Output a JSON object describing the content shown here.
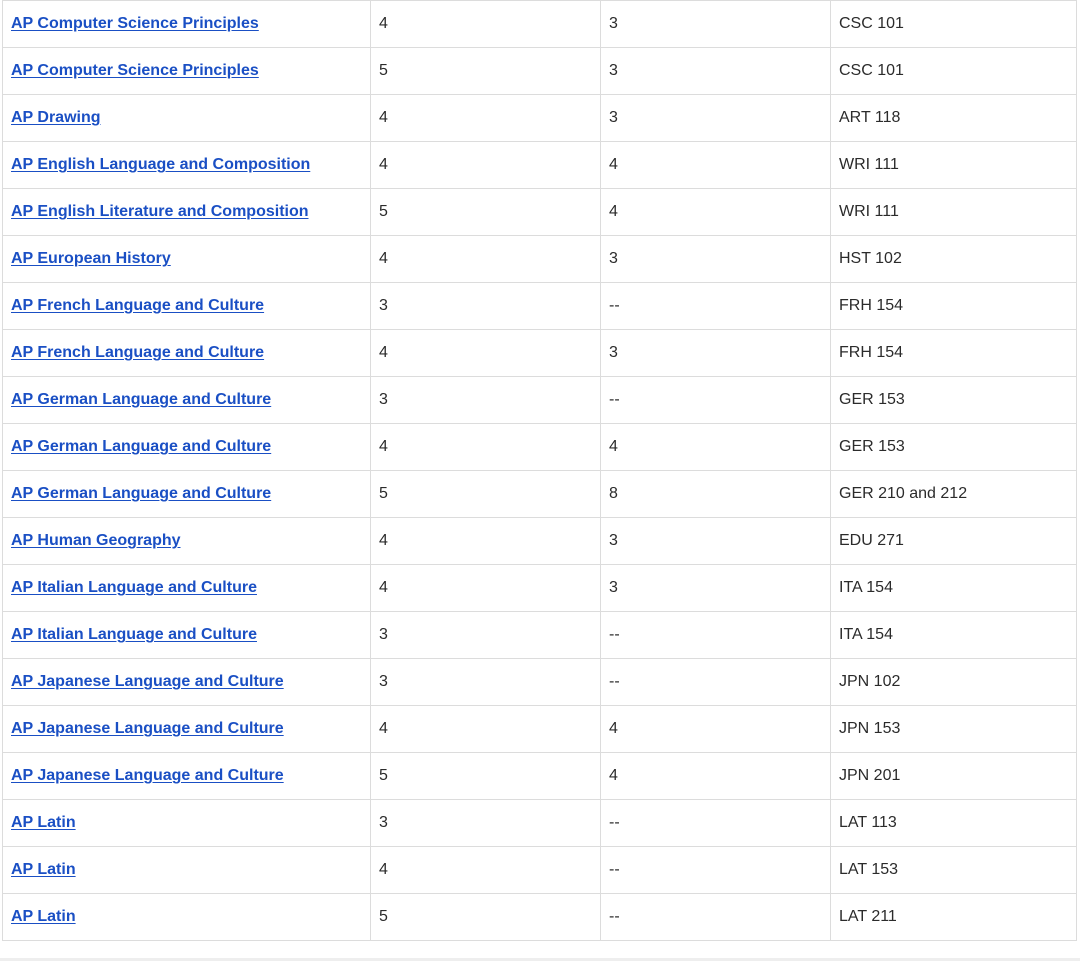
{
  "table": {
    "rows": [
      {
        "exam": "AP Computer Science Principles",
        "score": "4",
        "credits": "3",
        "course": "CSC 101"
      },
      {
        "exam": "AP Computer Science Principles",
        "score": "5",
        "credits": "3",
        "course": "CSC 101"
      },
      {
        "exam": "AP Drawing",
        "score": "4",
        "credits": "3",
        "course": "ART 118"
      },
      {
        "exam": "AP English Language and Composition",
        "score": "4",
        "credits": "4",
        "course": "WRI 111"
      },
      {
        "exam": "AP English Literature and Composition",
        "score": "5",
        "credits": "4",
        "course": "WRI 111"
      },
      {
        "exam": "AP European History",
        "score": "4",
        "credits": "3",
        "course": "HST 102"
      },
      {
        "exam": "AP French Language and Culture",
        "score": "3",
        "credits": "--",
        "course": "FRH 154"
      },
      {
        "exam": "AP French Language and Culture",
        "score": "4",
        "credits": "3",
        "course": "FRH 154"
      },
      {
        "exam": "AP German Language and Culture",
        "score": "3",
        "credits": "--",
        "course": "GER 153"
      },
      {
        "exam": "AP German Language and Culture",
        "score": "4",
        "credits": "4",
        "course": "GER 153"
      },
      {
        "exam": "AP German Language and Culture",
        "score": "5",
        "credits": "8",
        "course": "GER 210 and 212"
      },
      {
        "exam": "AP Human Geography",
        "score": "4",
        "credits": "3",
        "course": "EDU 271"
      },
      {
        "exam": "AP Italian Language and Culture",
        "score": "4",
        "credits": "3",
        "course": "ITA 154"
      },
      {
        "exam": "AP Italian Language and Culture",
        "score": "3",
        "credits": "--",
        "course": "ITA 154"
      },
      {
        "exam": "AP Japanese Language and Culture",
        "score": "3",
        "credits": "--",
        "course": "JPN 102"
      },
      {
        "exam": "AP Japanese Language and Culture",
        "score": "4",
        "credits": "4",
        "course": "JPN 153"
      },
      {
        "exam": "AP Japanese Language and Culture",
        "score": "5",
        "credits": "4",
        "course": "JPN 201"
      },
      {
        "exam": "AP Latin",
        "score": "3",
        "credits": "--",
        "course": "LAT 113"
      },
      {
        "exam": "AP Latin",
        "score": "4",
        "credits": "--",
        "course": "LAT 153"
      },
      {
        "exam": "AP Latin",
        "score": "5",
        "credits": "--",
        "course": "LAT 211"
      }
    ]
  },
  "colors": {
    "link": "#1a4fc4",
    "text": "#222222",
    "border": "#dcdcdc"
  }
}
